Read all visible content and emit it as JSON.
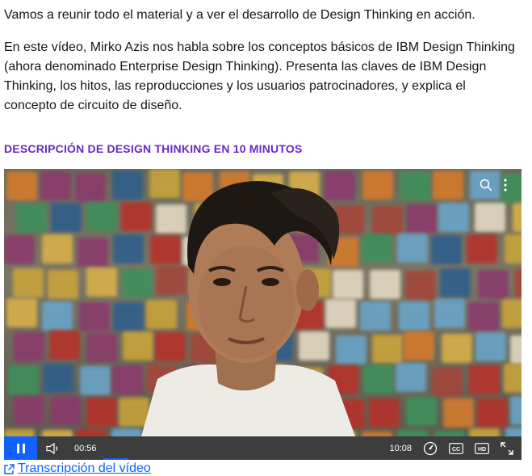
{
  "intro": {
    "paragraph1": "Vamos a reunir todo el material y a ver el desarrollo de Design Thinking en acción.",
    "paragraph2": "En este vídeo, Mirko Azis nos habla sobre los conceptos básicos de IBM Design Thinking (ahora denominado Enterprise Design Thinking). Presenta las claves de IBM Design Thinking, los hitos, las reproducciones y los usuarios patrocinadores, y explica el concepto de circuito de diseño."
  },
  "section": {
    "heading": "DESCRIPCIÓN DE DESIGN THINKING EN 10 MINUTOS"
  },
  "video": {
    "current_time": "00:56",
    "duration": "10:08",
    "progress_fraction": 0.092,
    "top_icons": [
      "search-icon",
      "more-vertical-icon"
    ],
    "control_icons": [
      "pause-icon",
      "volume-icon",
      "playback-speed-icon",
      "closed-captions-icon",
      "hd-icon",
      "fullscreen-icon"
    ]
  },
  "transcript": {
    "label": "Transcripción del vídeo",
    "icon": "external-link-icon"
  },
  "colors": {
    "heading": "#6929c4",
    "link": "#0f62fe",
    "play_button": "#0f62fe",
    "control_bar": "#3d3d3d"
  }
}
